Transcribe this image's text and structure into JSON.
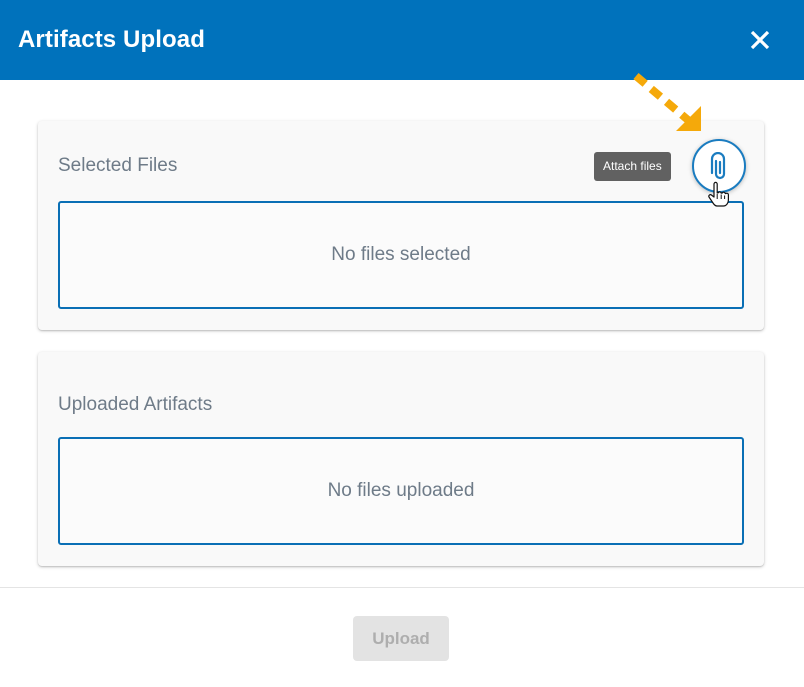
{
  "dialog": {
    "title": "Artifacts Upload"
  },
  "selected_files": {
    "title": "Selected Files",
    "empty_text": "No files selected"
  },
  "uploaded_artifacts": {
    "title": "Uploaded Artifacts",
    "empty_text": "No files uploaded"
  },
  "attach": {
    "tooltip": "Attach files",
    "icon": "paperclip-icon"
  },
  "footer": {
    "upload_label": "Upload",
    "upload_disabled": true
  },
  "colors": {
    "header": "#0072bc",
    "accent": "#1a7cc0",
    "annotation_arrow": "#f5a90a"
  }
}
